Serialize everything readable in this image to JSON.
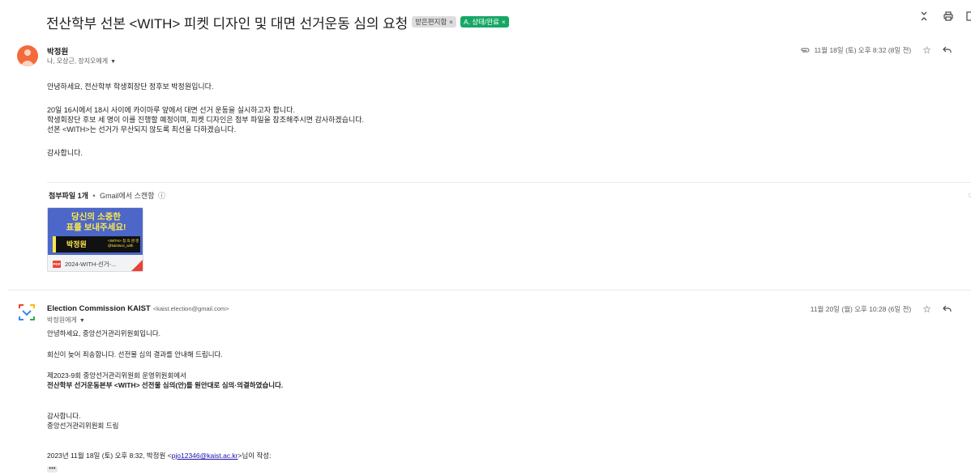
{
  "header": {
    "subject": "전산학부 선본 <WITH> 피켓 디자인 및 대면 선거운동 심의 요청",
    "labels": [
      {
        "text": "받은편지함",
        "close": "×",
        "bg": "#dddddd"
      },
      {
        "text": "A. 상태/완료",
        "close": "×",
        "bg": "#16a765"
      }
    ],
    "actions": [
      "expand-collapse-icon",
      "print-icon"
    ]
  },
  "message1": {
    "sender": "박정원",
    "recipients": "나, 오상근, 장지오에게",
    "date": "11월 18일 (토) 오후 8:32 (8일 전)",
    "body": [
      "안녕하세요, 전산학부 학생회장단 정후보 박정원입니다.",
      "",
      "20일 16시에서 18시 사이에 카이마루 앞에서 대면 선거 운동을 실시하고자 합니다.",
      "학생회장단 후보 세 명이 이를 진행할 예정이며, 피켓 디자인은 첨부 파일을 참조해주시면 감사하겠습니다.",
      "선본 <WITH>는 선거가 무산되지 않도록 최선을 다하겠습니다.",
      "",
      "감사합니다."
    ],
    "attachment": {
      "count_label": "첨부파일 1개",
      "separator": "•",
      "scan_label": "Gmail에서 스캔함",
      "poster_line1": "당신의 소중한",
      "poster_line2": "표를 보내주세요!",
      "poster_name": "박정원",
      "poster_small1": "<WITH> 정.의.랜.엔",
      "poster_small2": "@kaistsoc_with",
      "badge": "PDF",
      "file_name": "2024-WITH-선거-..."
    }
  },
  "message2": {
    "sender": "Election Commission KAIST",
    "sender_email": "<kaist.election@gmail.com>",
    "recipients": "박정원에게",
    "date": "11월 20일 (월) 오후 10:28 (6일 전)",
    "body_lines": {
      "l1": " 안녕하세요, 중앙선거관리위원회입니다.",
      "l2": "회신이 늦어 죄송합니다. 선전물 심의 결과를 안내해 드립니다.",
      "l3": "제2023-9회 중앙선거관리위원회 운영위원회에서",
      "l4": "전산학부 선거운동본부 <WITH> 선전물 심의(안)를 원안대로 심의·의결하였습니다.",
      "l5": "감사합니다.",
      "l6": "중앙선거관리위원회 드림"
    },
    "quote_prefix": "2023년 11월 18일 (토) 오후 8:32, 박정원 <",
    "quote_email": "pjo12346@kaist.ac.kr",
    "quote_suffix": ">님이 작성:",
    "ellipsis": "•••"
  }
}
